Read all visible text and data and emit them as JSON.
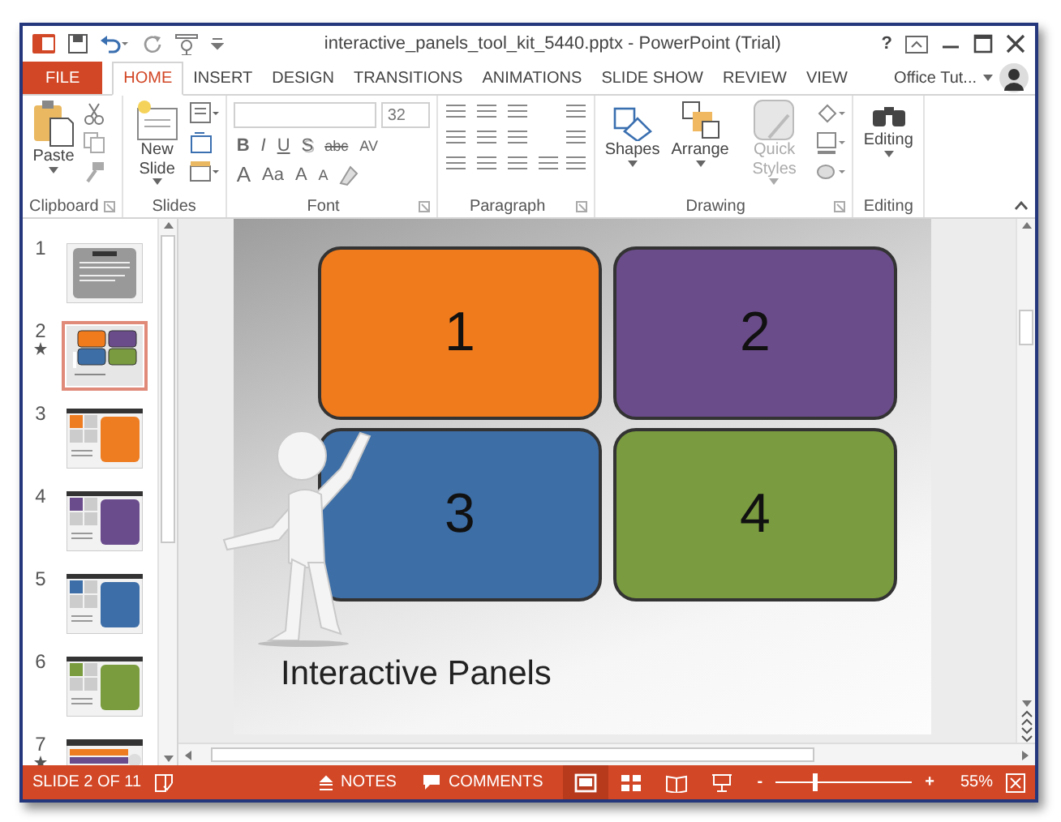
{
  "window": {
    "title": "interactive_panels_tool_kit_5440.pptx - PowerPoint (Trial)",
    "help": "?"
  },
  "tabs": [
    {
      "label": "FILE",
      "kind": "file",
      "selected": false
    },
    {
      "label": "HOME",
      "kind": "tab",
      "selected": true
    },
    {
      "label": "INSERT",
      "kind": "tab",
      "selected": false
    },
    {
      "label": "DESIGN",
      "kind": "tab",
      "selected": false
    },
    {
      "label": "TRANSITIONS",
      "kind": "tab",
      "selected": false
    },
    {
      "label": "ANIMATIONS",
      "kind": "tab",
      "selected": false
    },
    {
      "label": "SLIDE SHOW",
      "kind": "tab",
      "selected": false
    },
    {
      "label": "REVIEW",
      "kind": "tab",
      "selected": false
    },
    {
      "label": "VIEW",
      "kind": "tab",
      "selected": false
    }
  ],
  "account": {
    "name": "Office Tut..."
  },
  "ribbon": {
    "groups": [
      {
        "label": "Clipboard",
        "kind": "clipboard",
        "buttons": [
          {
            "label": "Paste",
            "disabled": false
          }
        ]
      },
      {
        "label": "Slides",
        "kind": "slides",
        "buttons": [
          {
            "label": "New Slide",
            "disabled": false
          }
        ]
      },
      {
        "label": "Font",
        "kind": "font",
        "font_size": "32",
        "format_buttons": [
          "B",
          "I",
          "U",
          "S",
          "abc",
          "AV"
        ],
        "size_buttons": [
          "A",
          "Aa",
          "A",
          "A"
        ]
      },
      {
        "label": "Paragraph",
        "kind": "paragraph"
      },
      {
        "label": "Drawing",
        "kind": "drawing",
        "buttons": [
          {
            "label": "Shapes",
            "disabled": false
          },
          {
            "label": "Arrange",
            "disabled": false
          },
          {
            "label": "Quick Styles",
            "disabled": true
          }
        ]
      },
      {
        "label": "Editing",
        "kind": "editing",
        "buttons": [
          {
            "label": "Editing",
            "disabled": false
          }
        ]
      }
    ]
  },
  "thumbnails": [
    {
      "number": "1",
      "kind": "title",
      "selected": false,
      "animated": false
    },
    {
      "number": "2",
      "kind": "panels",
      "selected": true,
      "animated": true
    },
    {
      "number": "3",
      "kind": "detail",
      "color": "#ee7d22",
      "selected": false,
      "animated": false
    },
    {
      "number": "4",
      "kind": "detail",
      "color": "#6a4b8c",
      "selected": false,
      "animated": false
    },
    {
      "number": "5",
      "kind": "detail",
      "color": "#3d6ea8",
      "selected": false,
      "animated": false
    },
    {
      "number": "6",
      "kind": "detail",
      "color": "#7a9c3e",
      "selected": false,
      "animated": false
    },
    {
      "number": "7",
      "kind": "list",
      "selected": false,
      "animated": true
    }
  ],
  "slide": {
    "panels": [
      {
        "label": "1",
        "color": "#f07b1c"
      },
      {
        "label": "2",
        "color": "#6b4c8a"
      },
      {
        "label": "3",
        "color": "#3d6ea6"
      },
      {
        "label": "4",
        "color": "#7a9b3f"
      }
    ],
    "title": "Interactive Panels"
  },
  "status_bar": {
    "slide": "SLIDE 2 OF 11",
    "notes": "NOTES",
    "comments": "COMMENTS",
    "views": [
      {
        "kind": "normal",
        "selected": true
      },
      {
        "kind": "sorter",
        "selected": false
      },
      {
        "kind": "reading",
        "selected": false
      },
      {
        "kind": "slideshow",
        "selected": false
      }
    ],
    "zoom": {
      "zoom_out": "-",
      "zoom_in": "+",
      "level": 0.27,
      "reading": "55%"
    }
  }
}
